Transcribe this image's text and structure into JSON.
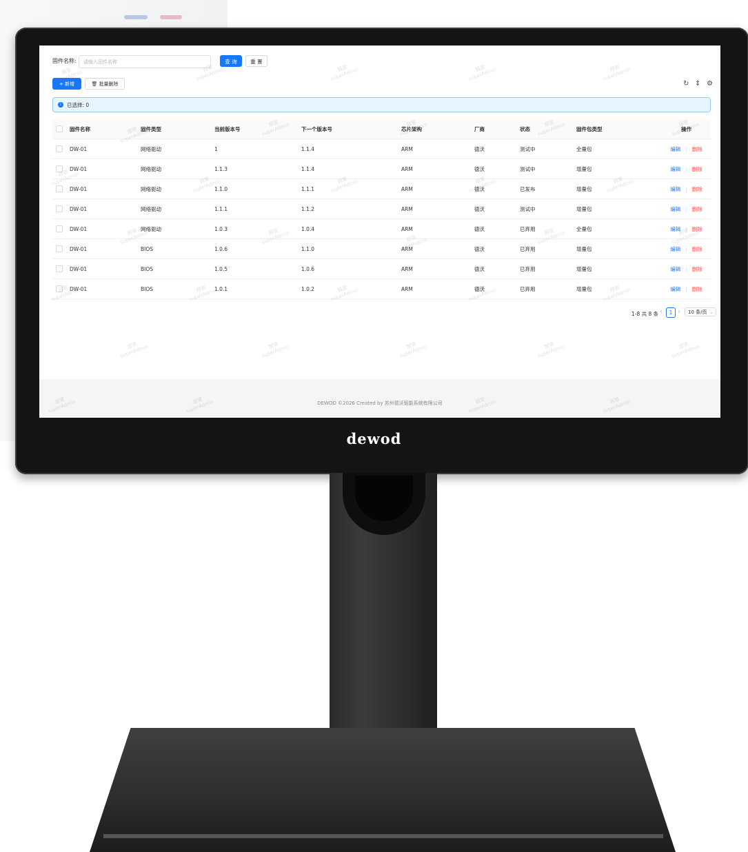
{
  "search": {
    "label": "固件名称:",
    "placeholder": "请输入固件名称",
    "query_label": "查 询",
    "reset_label": "重 置"
  },
  "toolbar": {
    "add_label": "+ 新增",
    "batch_delete_label": "批量删除",
    "icons": [
      "refresh-icon",
      "column-height-icon",
      "settings-icon"
    ]
  },
  "alert": {
    "text": "已选择: 0"
  },
  "table": {
    "columns": [
      "固件名称",
      "固件类型",
      "当前版本号",
      "下一个版本号",
      "芯片架构",
      "厂商",
      "状态",
      "固件包类型",
      "操作"
    ],
    "rows": [
      [
        "DW-01",
        "网络驱动",
        "1",
        "1.1.4",
        "ARM",
        "德沃",
        "测试中",
        "全量包"
      ],
      [
        "DW-01",
        "网络驱动",
        "1.1.3",
        "1.1.4",
        "ARM",
        "德沃",
        "测试中",
        "增量包"
      ],
      [
        "DW-01",
        "网络驱动",
        "1.1.0",
        "1.1.1",
        "ARM",
        "德沃",
        "已发布",
        "增量包"
      ],
      [
        "DW-01",
        "网络驱动",
        "1.1.1",
        "1.1.2",
        "ARM",
        "德沃",
        "测试中",
        "增量包"
      ],
      [
        "DW-01",
        "网络驱动",
        "1.0.3",
        "1.0.4",
        "ARM",
        "德沃",
        "已弃用",
        "全量包"
      ],
      [
        "DW-01",
        "BIOS",
        "1.0.6",
        "1.1.0",
        "ARM",
        "德沃",
        "已弃用",
        "增量包"
      ],
      [
        "DW-01",
        "BIOS",
        "1.0.5",
        "1.0.6",
        "ARM",
        "德沃",
        "已弃用",
        "增量包"
      ],
      [
        "DW-01",
        "BIOS",
        "1.0.1",
        "1.0.2",
        "ARM",
        "德沃",
        "已弃用",
        "增量包"
      ]
    ],
    "edit_label": "编辑",
    "delete_label": "删除"
  },
  "pagination": {
    "summary": "1-8 共 8 条",
    "current_page": "1",
    "page_size": "10 条/页"
  },
  "footer": {
    "text": "DEWOD ©2026 Created by 苏州德沃智能系统有限公司"
  },
  "watermark": {
    "line1": "超管",
    "line2": "superAdmin"
  },
  "device": {
    "brand": "dewod"
  },
  "colors": {
    "primary": "#1677ff",
    "danger": "#ff4d4f",
    "alert_bg": "#e6f4ff"
  }
}
